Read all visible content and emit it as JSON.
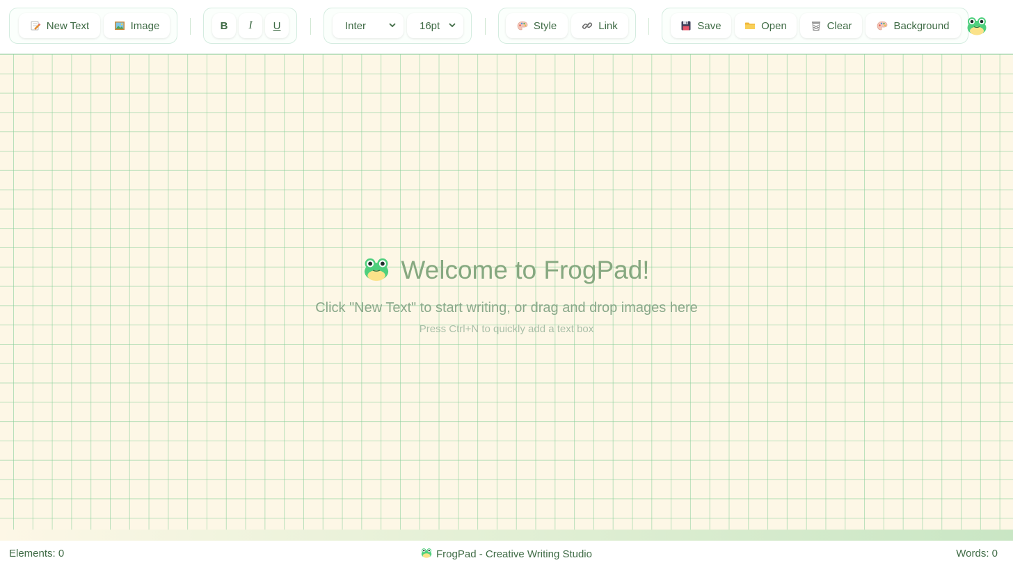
{
  "toolbar": {
    "new_text_label": "New Text",
    "image_label": "Image",
    "bold_label": "B",
    "italic_label": "I",
    "underline_label": "U",
    "font_value": "Inter",
    "size_value": "16pt",
    "style_label": "Style",
    "link_label": "Link",
    "save_label": "Save",
    "open_label": "Open",
    "clear_label": "Clear",
    "background_label": "Background"
  },
  "canvas": {
    "welcome_title": "Welcome to FrogPad!",
    "welcome_subtitle": "Click \"New Text\" to start writing, or drag and drop images here",
    "welcome_hint": "Press Ctrl+N to quickly add a text box"
  },
  "status": {
    "elements": "Elements: 0",
    "app_name": "FrogPad - Creative Writing Studio",
    "words": "Words: 0"
  },
  "icons": {
    "new_text": "memo-pencil-icon",
    "image": "framed-picture-icon",
    "style": "palette-icon",
    "link": "chain-link-icon",
    "save": "floppy-disk-icon",
    "open": "folder-icon",
    "clear": "wastebasket-icon",
    "background": "palette-icon",
    "logo": "frog-icon",
    "dropdown": "chevron-down-icon"
  },
  "colors": {
    "accent_green": "#3f6b45",
    "canvas_bg": "#fdf7e6",
    "grid_line": "#82cd96",
    "welcome_text": "#86a880"
  }
}
